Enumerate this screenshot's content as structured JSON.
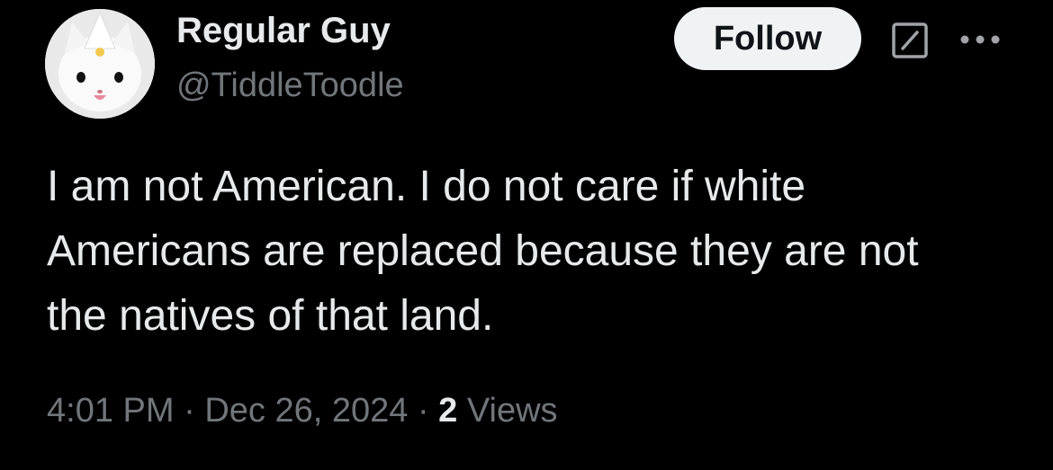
{
  "author": {
    "display_name": "Regular Guy",
    "handle": "@TiddleToodle",
    "avatar": "white-cat-avatar"
  },
  "actions": {
    "follow_label": "Follow",
    "grok_icon": "grok-icon",
    "more_icon": "more-horizontal-icon"
  },
  "post": {
    "lines": [
      "I am not American. I do not care if white",
      "Americans are replaced because they are not",
      "the natives of that land."
    ]
  },
  "meta": {
    "time": "4:01 PM",
    "separator": "·",
    "date": "Dec 26, 2024",
    "views_count": "2",
    "views_label": "Views"
  },
  "colors": {
    "background": "#000000",
    "primary_text": "#e7e9ea",
    "secondary_text": "#71767b",
    "follow_bg": "#eff3f4",
    "follow_text": "#0f1419"
  }
}
